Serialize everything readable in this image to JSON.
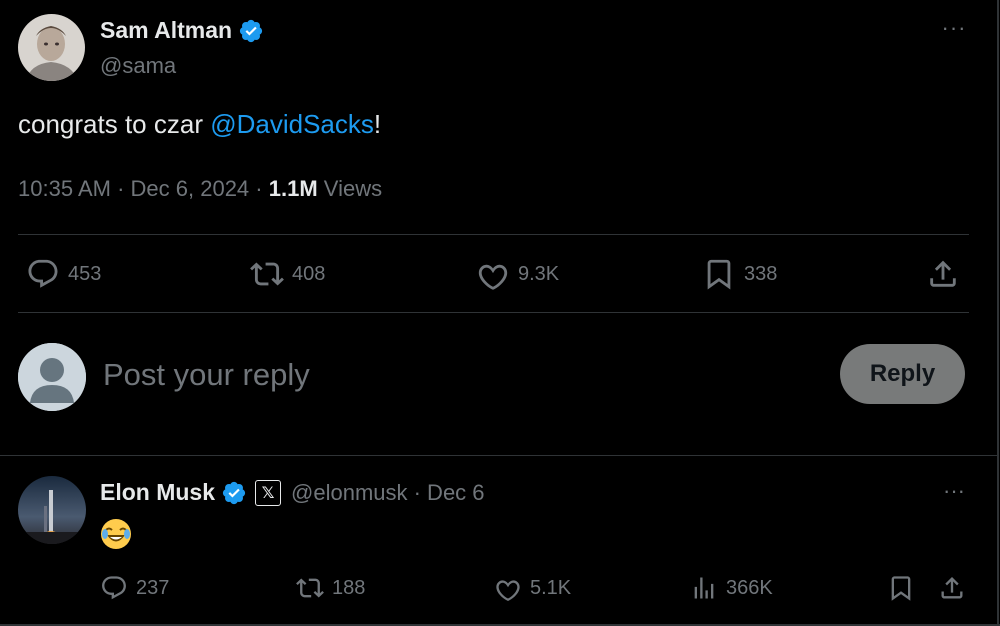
{
  "main_tweet": {
    "author_name": "Sam Altman",
    "handle": "@sama",
    "more_glyph": "···",
    "text_prefix": "congrats to czar ",
    "mention": "@DavidSacks",
    "text_suffix": "!",
    "time": "10:35 AM",
    "date": "Dec 6, 2024",
    "views_count": "1.1M",
    "views_label": "Views",
    "stats": {
      "replies": "453",
      "reposts": "408",
      "likes": "9.3K",
      "bookmarks": "338"
    }
  },
  "composer": {
    "placeholder": "Post your reply",
    "button_label": "Reply"
  },
  "reply_tweet": {
    "author_name": "Elon Musk",
    "badge_glyph": "𝕏",
    "handle_date": "@elonmusk · Dec 6",
    "more_glyph": "···",
    "stats": {
      "replies": "237",
      "reposts": "188",
      "likes": "5.1K",
      "views": "366K"
    }
  },
  "colors": {
    "background": "#000000",
    "text": "#e7e9ea",
    "muted": "#71767b",
    "link": "#1d9bf0",
    "divider": "#2f3336",
    "reply_button": "#787a7a"
  },
  "icons": [
    "verified-badge-icon",
    "more-icon",
    "reply-icon",
    "repost-icon",
    "like-icon",
    "bookmark-icon",
    "share-icon",
    "views-icon",
    "x-badge-icon",
    "laughing-emoji-icon"
  ]
}
